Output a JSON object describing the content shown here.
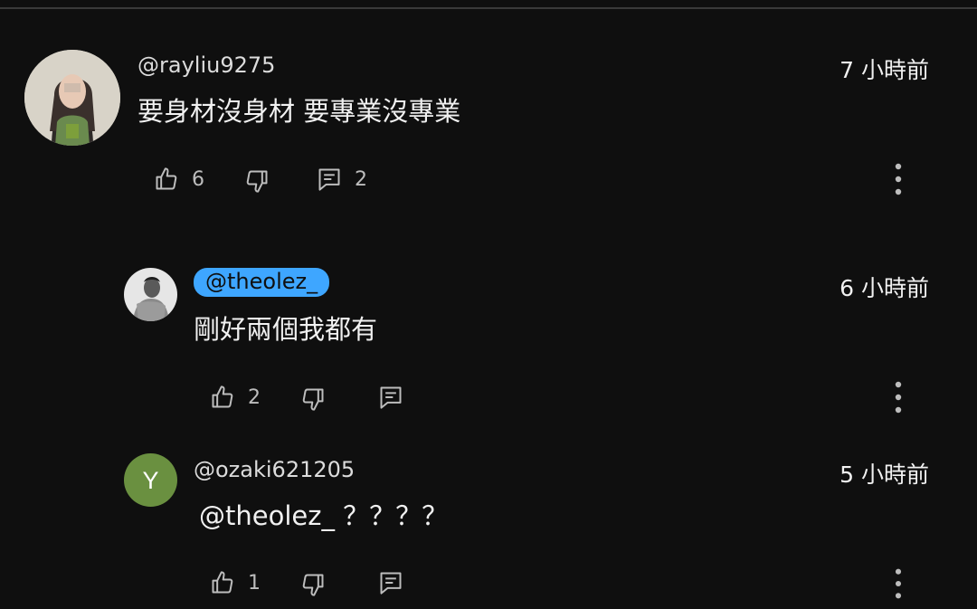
{
  "comments": [
    {
      "author": "@rayliu9275",
      "timestamp": "7 小時前",
      "text": "要身材沒身材 要專業沒專業",
      "likes": "6",
      "replies": "2"
    },
    {
      "author": "@theolez_",
      "timestamp": "6 小時前",
      "text": "剛好兩個我都有",
      "likes": "2",
      "replies": ""
    },
    {
      "author": "@ozaki621205",
      "avatar_letter": "Y",
      "avatar_color": "#6a9040",
      "timestamp": "5 小時前",
      "text": "@theolez_ ？？？？",
      "likes": "1",
      "replies": ""
    }
  ],
  "colors": {
    "background": "#0f0f0f",
    "highlight_badge": "#3ea6ff"
  },
  "icons": [
    "thumbs-up-icon",
    "thumbs-down-icon",
    "reply-icon",
    "more-vert-icon"
  ]
}
